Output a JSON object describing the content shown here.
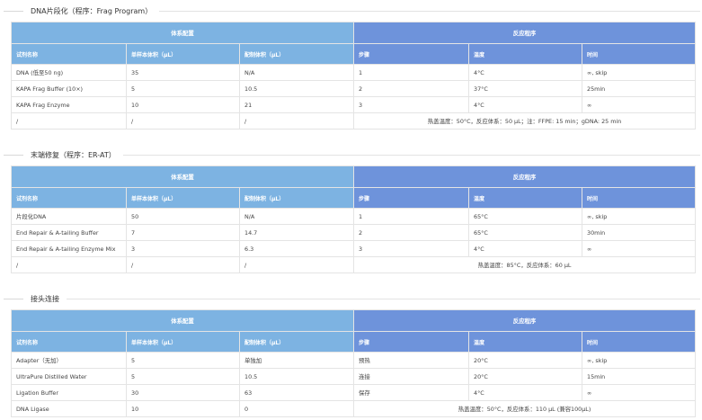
{
  "sections": [
    {
      "title": "DNA片段化（程序：Frag Program）",
      "group_left": "体系配置",
      "group_right": "反应程序",
      "columns": [
        "试剂名称",
        "单样本体积（μL）",
        "配制体积（μL）",
        "步骤",
        "温度",
        "时间"
      ],
      "rows": [
        [
          "DNA (低至50 ng)",
          "35",
          "N/A",
          "1",
          "4°C",
          "∞, skip"
        ],
        [
          "KAPA Frag Buffer (10×)",
          "5",
          "10.5",
          "2",
          "37°C",
          "25min"
        ],
        [
          "KAPA Frag Enzyme",
          "10",
          "21",
          "3",
          "4°C",
          "∞"
        ]
      ],
      "footer": [
        "/",
        "/",
        "/"
      ],
      "note": "热盖温度：50°C，反应体系：50 μL；注：FFPE: 15 min；gDNA: 25 min"
    },
    {
      "title": "末端修复（程序：ER-AT）",
      "group_left": "体系配置",
      "group_right": "反应程序",
      "columns": [
        "试剂名称",
        "单样本体积（μL）",
        "配制体积（μL）",
        "步骤",
        "温度",
        "时间"
      ],
      "rows": [
        [
          "片段化DNA",
          "50",
          "N/A",
          "1",
          "65°C",
          "∞, skip"
        ],
        [
          "End Repair & A-tailing Buffer",
          "7",
          "14.7",
          "2",
          "65°C",
          "30min"
        ],
        [
          "End Repair & A-tailing Enzyme Mix",
          "3",
          "6.3",
          "3",
          "4°C",
          "∞"
        ]
      ],
      "footer": [
        "/",
        "/",
        "/"
      ],
      "note": "热盖温度：85°C，反应体系：60 μL"
    },
    {
      "title": "接头连接",
      "group_left": "体系配置",
      "group_right": "反应程序",
      "columns": [
        "试剂名称",
        "单样本体积（μL）",
        "配制体积（μL）",
        "步骤",
        "温度",
        "时间"
      ],
      "rows": [
        [
          "Adapter（无加）",
          "5",
          "单独加",
          "预热",
          "20°C",
          "∞, skip"
        ],
        [
          "UltraPure Distilled Water",
          "5",
          "10.5",
          "连接",
          "20°C",
          "15min"
        ],
        [
          "Ligation Buffer",
          "30",
          "63",
          "保存",
          "4°C",
          "∞"
        ]
      ],
      "footer": [
        "DNA Ligase",
        "10",
        "0"
      ],
      "note": "热盖温度：50°C，反应体系：110 μL (兼容100μL)"
    }
  ]
}
